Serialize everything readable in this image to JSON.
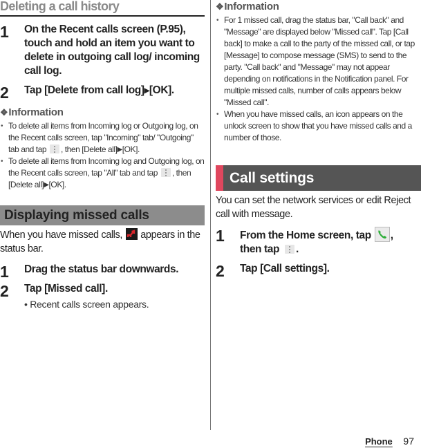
{
  "left": {
    "title": "Deleting a call history",
    "steps": [
      {
        "num": "1",
        "text": "On the Recent calls screen (P.95), touch and hold an item you want to delete in outgoing call log/ incoming call log."
      },
      {
        "num": "2",
        "pre": "Tap [Delete from call log]",
        "arrow": "▶",
        "post": "[OK]."
      }
    ],
    "info": {
      "diamond": "❖",
      "heading": "Information",
      "bullets": [
        {
          "pre": "To delete all items from Incoming log or Outgoing log, on the Recent calls screen, tap \"Incoming\" tab/ \"Outgoing\" tab and tap",
          "mid": ", then [Delete all]",
          "arrow": "▶",
          "post": "[OK]."
        },
        {
          "pre": "To delete all items from Incoming log and Outgoing log, on the Recent calls screen, tap \"All\" tab and tap",
          "mid": ", then [Delete all]",
          "arrow": "▶",
          "post": "[OK]."
        }
      ]
    },
    "missed_section": {
      "heading": "Displaying missed calls",
      "intro_pre": "When you have missed calls,",
      "intro_post": "appears in the status bar.",
      "steps": [
        {
          "num": "1",
          "text": "Drag the status bar downwards."
        },
        {
          "num": "2",
          "text": "Tap [Missed call].",
          "sub": "• Recent calls screen appears."
        }
      ]
    }
  },
  "right": {
    "info": {
      "diamond": "❖",
      "heading": "Information",
      "bullets": [
        "For 1 missed call, drag the status bar, \"Call back\" and \"Message\" are displayed below \"Missed call\". Tap [Call back] to make a call to the party of the missed call, or tap [Message] to compose message (SMS) to send to the party. \"Call back\" and \"Message\" may not appear depending on notifications in the Notification panel. For multiple missed calls, number of calls appears below \"Missed call\".",
        "When you have missed calls, an icon appears on the unlock screen to show that you have missed calls and a number of those."
      ]
    },
    "call_settings": {
      "heading": "Call settings",
      "intro": "You can set the network services or edit Reject call with message.",
      "steps": [
        {
          "num": "1",
          "pre": "From the Home screen, tap",
          "mid": ",",
          "line2_pre": "then tap",
          "post": "."
        },
        {
          "num": "2",
          "text": "Tap [Call settings]."
        }
      ]
    }
  },
  "footer": {
    "section": "Phone",
    "page": "97"
  },
  "colors": {
    "accent_red": "#e0475e",
    "band_dark": "#555555",
    "band_gray": "#8c8c8c",
    "phone_green": "#2fae3a",
    "missed_red": "#d8262c"
  }
}
